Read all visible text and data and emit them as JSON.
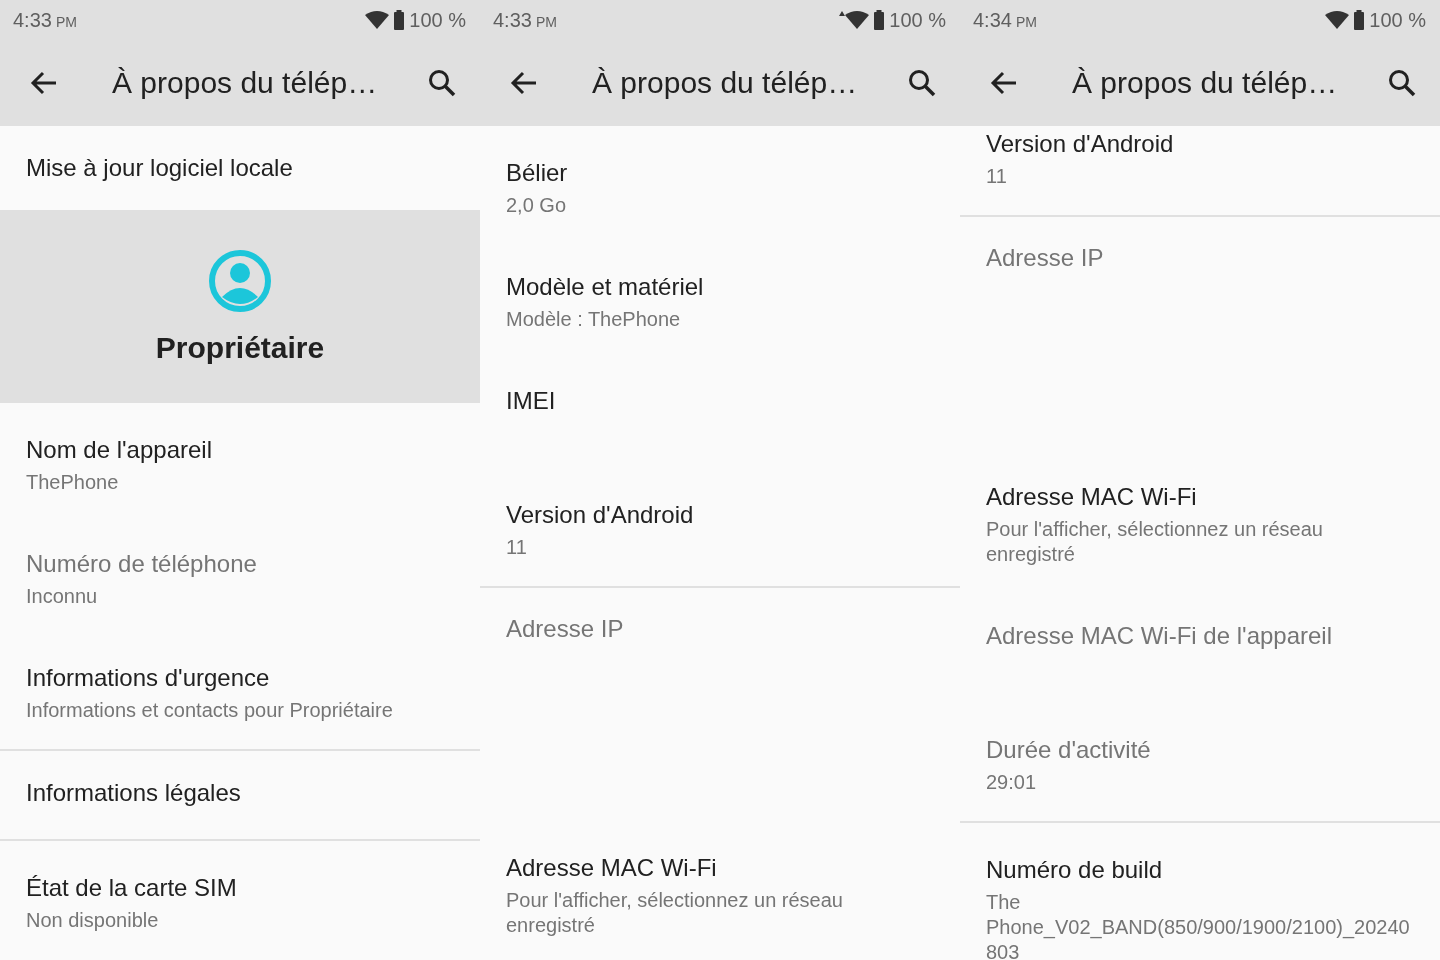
{
  "panels": [
    {
      "status_bar": {
        "time": "4:33",
        "ampm": "PM",
        "wifi_activity": false,
        "battery": "100 %"
      },
      "app_bar": {
        "title": "À propos du télép…"
      },
      "scrolled": false,
      "items": [
        {
          "kind": "single",
          "title": "Mise à jour logiciel locale",
          "disabled": false
        },
        {
          "kind": "profile",
          "title": "Propriétaire"
        },
        {
          "kind": "item",
          "title": "Nom de l'appareil",
          "summary": "ThePhone",
          "disabled": false
        },
        {
          "kind": "item",
          "title": "Numéro de téléphone",
          "summary": "Inconnu",
          "disabled": true
        },
        {
          "kind": "item",
          "title": "Informations d'urgence",
          "summary": "Informations et contacts pour Propriétaire",
          "disabled": false
        },
        {
          "kind": "divider"
        },
        {
          "kind": "single",
          "title": "Informations légales",
          "disabled": false
        },
        {
          "kind": "divider"
        },
        {
          "kind": "item",
          "title": "État de la carte SIM",
          "summary": "Non disponible",
          "disabled": false
        }
      ]
    },
    {
      "status_bar": {
        "time": "4:33",
        "ampm": "PM",
        "wifi_activity": true,
        "battery": "100 %"
      },
      "app_bar": {
        "title": "À propos du télép…"
      },
      "scrolled": false,
      "items": [
        {
          "kind": "item",
          "title": "Bélier",
          "summary": "2,0 Go",
          "disabled": false
        },
        {
          "kind": "item",
          "title": "Modèle et matériel",
          "summary": "Modèle : ThePhone",
          "disabled": false
        },
        {
          "kind": "item",
          "title": "IMEI",
          "disabled": false
        },
        {
          "kind": "item",
          "title": "Version d'Android",
          "summary": "11",
          "disabled": false
        },
        {
          "kind": "divider"
        },
        {
          "kind": "tall",
          "title": "Adresse IP",
          "disabled": true
        },
        {
          "kind": "item",
          "title": "Adresse MAC Wi-Fi",
          "summary": "Pour l'afficher, sélectionnez un réseau enregistré",
          "disabled": false
        }
      ]
    },
    {
      "status_bar": {
        "time": "4:34",
        "ampm": "PM",
        "wifi_activity": false,
        "battery": "100 %"
      },
      "app_bar": {
        "title": "À propos du télép…"
      },
      "scrolled": true,
      "items": [
        {
          "kind": "item",
          "title": "Version d'Android",
          "summary": "11",
          "disabled": false
        },
        {
          "kind": "divider"
        },
        {
          "kind": "tall",
          "title": "Adresse IP",
          "disabled": true
        },
        {
          "kind": "item",
          "title": "Adresse MAC Wi-Fi",
          "summary": "Pour l'afficher, sélectionnez un réseau enregistré",
          "disabled": false
        },
        {
          "kind": "item",
          "title": "Adresse MAC Wi-Fi de l'appareil",
          "disabled": true
        },
        {
          "kind": "item",
          "title": "Durée d'activité",
          "summary": "29:01",
          "disabled": true
        },
        {
          "kind": "divider"
        },
        {
          "kind": "item",
          "title": "Numéro de build",
          "summary": "The Phone_V02_BAND(850/900/1900/2100)_20240803",
          "disabled": false
        }
      ]
    }
  ]
}
